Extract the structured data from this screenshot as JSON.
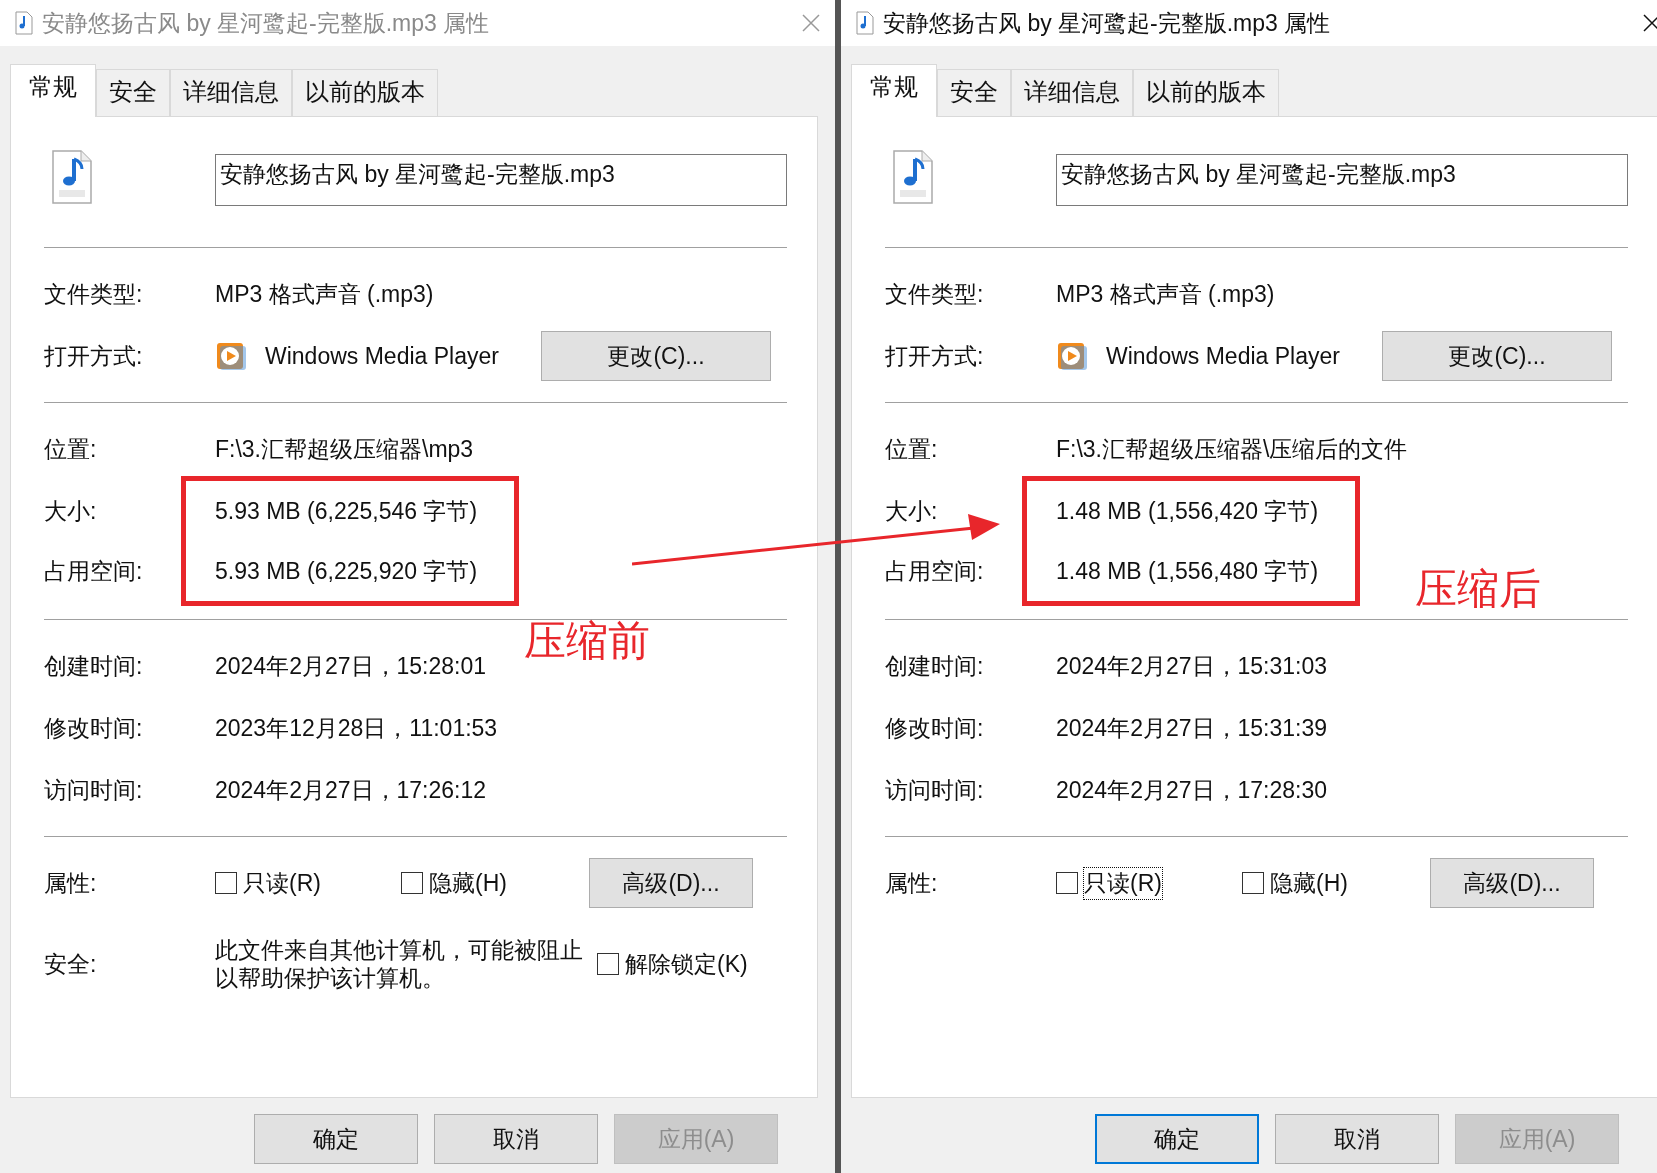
{
  "dialogs": [
    {
      "active": false,
      "title": "安静悠扬古风 by 星河鹭起-完整版.mp3 属性",
      "tabs": [
        {
          "label": "常规",
          "selected": true
        },
        {
          "label": "安全",
          "selected": false
        },
        {
          "label": "详细信息",
          "selected": false
        },
        {
          "label": "以前的版本",
          "selected": false
        }
      ],
      "filename": "安静悠扬古风 by 星河鹭起-完整版.mp3",
      "file_type": {
        "label": "文件类型:",
        "value": "MP3 格式声音 (.mp3)"
      },
      "opens_with": {
        "label": "打开方式:",
        "app": "Windows Media Player",
        "button": "更改(C)..."
      },
      "location": {
        "label": "位置:",
        "value": "F:\\3.汇帮超级压缩器\\mp3"
      },
      "size": {
        "label": "大小:",
        "value": "5.93 MB (6,225,546 字节)"
      },
      "size_on_disk": {
        "label": "占用空间:",
        "value": "5.93 MB (6,225,920 字节)"
      },
      "annotation": {
        "text": "压缩前"
      },
      "times": [
        {
          "label": "创建时间:",
          "value": "2024年2月27日，15:28:01"
        },
        {
          "label": "修改时间:",
          "value": "2023年12月28日，11:01:53"
        },
        {
          "label": "访问时间:",
          "value": "2024年2月27日，17:26:12"
        }
      ],
      "attributes": {
        "label": "属性:",
        "options": [
          {
            "label": "只读(R)",
            "checked": false,
            "focused": false
          },
          {
            "label": "隐藏(H)",
            "checked": false,
            "focused": false
          }
        ],
        "button": "高级(D)..."
      },
      "security": {
        "label": "安全:",
        "text": "此文件来自其他计算机，可能被阻止以帮助保护该计算机。",
        "option": {
          "label": "解除锁定(K)",
          "checked": false
        }
      },
      "buttons": [
        {
          "label": "确定",
          "disabled": false,
          "default": false
        },
        {
          "label": "取消",
          "disabled": false,
          "default": false
        },
        {
          "label": "应用(A)",
          "disabled": true,
          "default": false
        }
      ]
    },
    {
      "active": true,
      "title": "安静悠扬古风 by 星河鹭起-完整版.mp3 属性",
      "tabs": [
        {
          "label": "常规",
          "selected": true
        },
        {
          "label": "安全",
          "selected": false
        },
        {
          "label": "详细信息",
          "selected": false
        },
        {
          "label": "以前的版本",
          "selected": false
        }
      ],
      "filename": "安静悠扬古风 by 星河鹭起-完整版.mp3",
      "file_type": {
        "label": "文件类型:",
        "value": "MP3 格式声音 (.mp3)"
      },
      "opens_with": {
        "label": "打开方式:",
        "app": "Windows Media Player",
        "button": "更改(C)..."
      },
      "location": {
        "label": "位置:",
        "value": "F:\\3.汇帮超级压缩器\\压缩后的文件"
      },
      "size": {
        "label": "大小:",
        "value": "1.48 MB (1,556,420 字节)"
      },
      "size_on_disk": {
        "label": "占用空间:",
        "value": "1.48 MB (1,556,480 字节)"
      },
      "annotation": {
        "text": "压缩后"
      },
      "times": [
        {
          "label": "创建时间:",
          "value": "2024年2月27日，15:31:03"
        },
        {
          "label": "修改时间:",
          "value": "2024年2月27日，15:31:39"
        },
        {
          "label": "访问时间:",
          "value": "2024年2月27日，17:28:30"
        }
      ],
      "attributes": {
        "label": "属性:",
        "options": [
          {
            "label": "只读(R)",
            "checked": false,
            "focused": true
          },
          {
            "label": "隐藏(H)",
            "checked": false,
            "focused": false
          }
        ],
        "button": "高级(D)..."
      },
      "buttons": [
        {
          "label": "确定",
          "disabled": false,
          "default": true
        },
        {
          "label": "取消",
          "disabled": false,
          "default": false
        },
        {
          "label": "应用(A)",
          "disabled": true,
          "default": false
        }
      ]
    }
  ]
}
